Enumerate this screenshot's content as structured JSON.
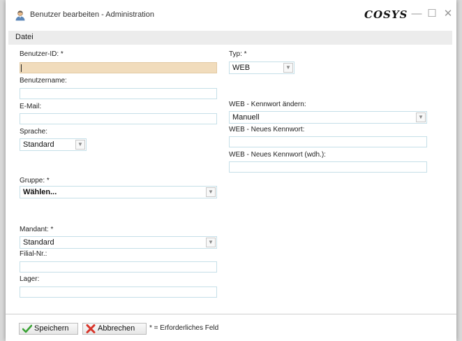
{
  "window": {
    "title": "Benutzer bearbeiten - Administration",
    "brand": "COSYS",
    "controls": {
      "minimize": "—",
      "maximize": "☐",
      "close": "✕"
    }
  },
  "menu": {
    "items": [
      {
        "label": "Datei"
      }
    ]
  },
  "form": {
    "benutzer_id": {
      "label": "Benutzer-ID: *",
      "value": ""
    },
    "benutzername": {
      "label": "Benutzername:",
      "value": ""
    },
    "email": {
      "label": "E-Mail:",
      "value": ""
    },
    "sprache": {
      "label": "Sprache:",
      "value": "Standard"
    },
    "gruppe": {
      "label": "Gruppe: *",
      "value": "Wählen..."
    },
    "mandant": {
      "label": "Mandant: *",
      "value": "Standard"
    },
    "filial_nr": {
      "label": "Filial-Nr.:",
      "value": ""
    },
    "lager": {
      "label": "Lager:",
      "value": ""
    },
    "typ": {
      "label": "Typ: *",
      "value": "WEB"
    },
    "web_kennwort_aendern": {
      "label": "WEB - Kennwort ändern:",
      "value": "Manuell"
    },
    "web_neues_kennwort": {
      "label": "WEB - Neues Kennwort:",
      "value": ""
    },
    "web_neues_kennwort_wdh": {
      "label": "WEB - Neues Kennwort (wdh.):",
      "value": ""
    }
  },
  "footer": {
    "save_label": "Speichern",
    "cancel_label": "Abbrechen",
    "required_note": "* = Erforderliches Feld"
  },
  "colors": {
    "focused_field": "#f1dcbc",
    "field_border": "#c5dfe8",
    "save_icon": "#3aa335",
    "cancel_icon": "#d8352a"
  },
  "icons": {
    "title": "user-admin-icon",
    "save": "check-icon",
    "cancel": "cross-icon",
    "dropdown": "chevron-down-icon"
  }
}
